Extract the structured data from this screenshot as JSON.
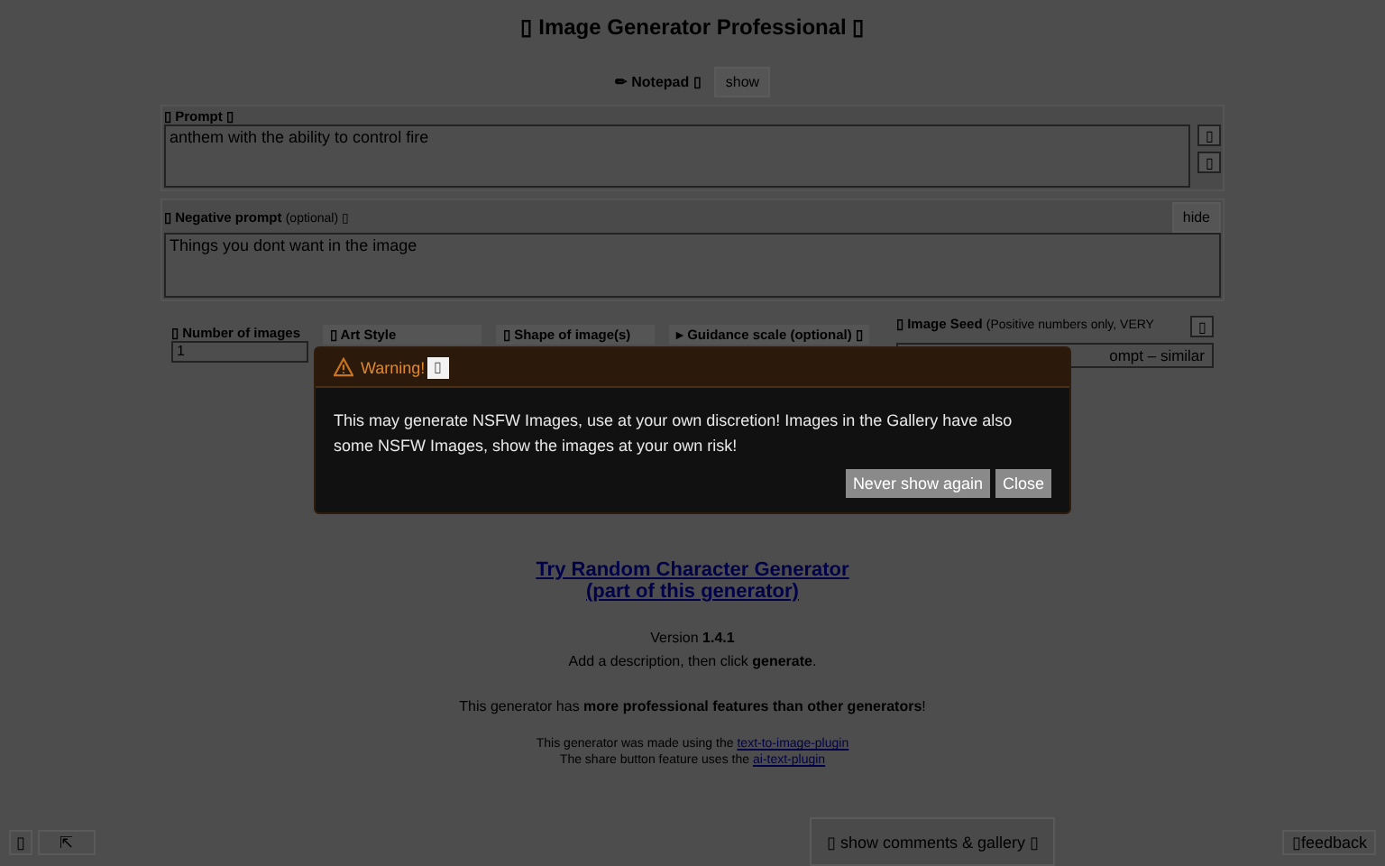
{
  "title": "▯ Image Generator Professional ▯",
  "notepad": {
    "label": "✏ Notepad ▯",
    "button": "show"
  },
  "prompt": {
    "label": "▯ Prompt ▯",
    "value": "anthem with the ability to control fire",
    "side_buttons": [
      "▯",
      "▯"
    ]
  },
  "negative_prompt": {
    "label": "▯ Negative prompt",
    "note": "(optional)",
    "icon": "▯",
    "placeholder": "Things you dont want in the image",
    "button": "hide"
  },
  "options": [
    {
      "kind": "select",
      "label": "▯ Number of images",
      "value": "1"
    },
    {
      "kind": "label",
      "label": "▯ Art Style"
    },
    {
      "kind": "label",
      "label": "▯ Shape of image(s)"
    },
    {
      "kind": "label",
      "label": "▸ Guidance scale (optional) ▯"
    },
    {
      "kind": "seed",
      "label": "▯ Image Seed",
      "note": "(Positive numbers only, VERY",
      "value": "ompt – similar",
      "button": "▯"
    }
  ],
  "dialog": {
    "title": "Warning!",
    "title_button": "▯",
    "message": "This may generate NSFW Images, use at your own discretion! Images in the Gallery have also some NSFW Images, show the images at your own risk!",
    "buttons": [
      "Never show again",
      "Close"
    ]
  },
  "link": {
    "line1": "Try Random Character Generator",
    "line2": "(part of this generator)"
  },
  "version": "Version **1.4.1**",
  "hint": "Add a description, then click **generate**.",
  "features": "This generator has **more professional features than other generators**!",
  "credits": [
    {
      "text": "This generator was made using the",
      "link": "text-to-image-plugin"
    },
    {
      "text": "The share button feature uses the",
      "link": "ai-text-plugin"
    }
  ],
  "footer": {
    "left_buttons": [
      "▯",
      "⇱"
    ],
    "center": "▯ show comments & gallery ▯",
    "right": "▯feedback"
  }
}
